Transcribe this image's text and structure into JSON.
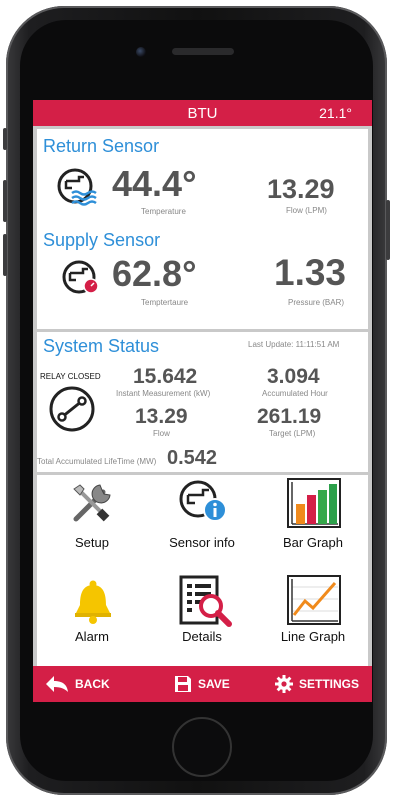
{
  "header": {
    "title": "BTU",
    "temperature": "21.1°"
  },
  "return_sensor": {
    "title": "Return Sensor",
    "temperature": "44.4°",
    "temperature_label": "Temperature",
    "flow": "13.29",
    "flow_label": "Flow (LPM)"
  },
  "supply_sensor": {
    "title": "Supply Sensor",
    "temperature": "62.8°",
    "temperature_label": "Temptertaure",
    "pressure": "1.33",
    "pressure_label": "Pressure (BAR)"
  },
  "system_status": {
    "title": "System Status",
    "last_update": "Last Update: 11:11:51 AM",
    "relay": "RELAY CLOSED",
    "instant_value": "15.642",
    "instant_label": "Instant Measurement (kW)",
    "accumulated_value": "3.094",
    "accumulated_label": "Accumulated Hour",
    "flow_value": "13.29",
    "flow_label": "Flow",
    "target_value": "261.19",
    "target_label": "Target (LPM)",
    "lifetime_label": "Total Accumulated LifeTime (MW)",
    "lifetime_value": "0.542"
  },
  "menu": {
    "setup": "Setup",
    "sensor_info": "Sensor info",
    "bar_graph": "Bar Graph",
    "alarm": "Alarm",
    "details": "Details",
    "line_graph": "Line Graph"
  },
  "bottom_bar": {
    "back": "BACK",
    "save": "SAVE",
    "settings": "SETTINGS"
  },
  "colors": {
    "accent": "#d41f47",
    "heading": "#2e8fd8",
    "value": "#555555"
  }
}
